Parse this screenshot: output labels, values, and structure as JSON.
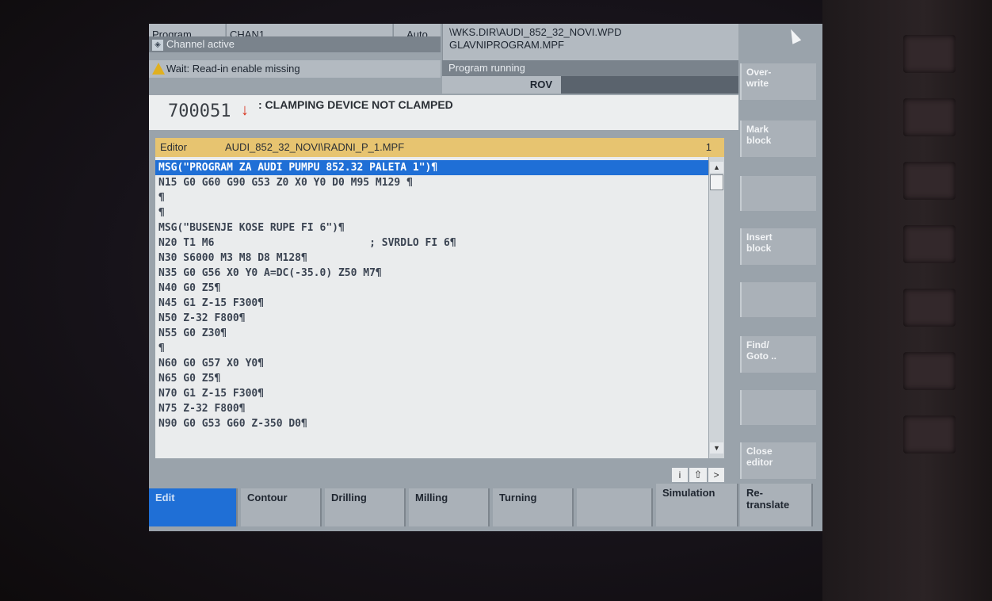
{
  "header": {
    "program_label": "Program",
    "channel": "CHAN1",
    "mode": "Auto",
    "path_line1": "\\WKS.DIR\\AUDI_852_32_NOVI.WPD",
    "path_line2": "GLAVNIPROGRAM.MPF",
    "channel_status": "Channel active",
    "program_status": "Program running",
    "warning": "Wait: Read-in enable missing",
    "rov": "ROV"
  },
  "alarm": {
    "number": "700051",
    "arrow": "↓",
    "text": ": CLAMPING DEVICE NOT CLAMPED"
  },
  "editor": {
    "label": "Editor",
    "file": "AUDI_852_32_NOVI\\RADNI_P_1.MPF",
    "count": "1",
    "lines": [
      "MSG(\"PROGRAM ZA AUDI PUMPU 852.32 PALETA 1\")¶",
      "N15 G0 G60 G90 G53 Z0 X0 Y0 D0 M95 M129 ¶",
      "¶",
      "¶",
      "MSG(\"BUSENJE KOSE RUPE FI 6\")¶",
      "N20 T1 M6                         ; SVRDLO FI 6¶",
      "N30 S6000 M3 M8 D8 M128¶",
      "N35 G0 G56 X0 Y0 A=DC(-35.0) Z50 M7¶",
      "N40 G0 Z5¶",
      "N45 G1 Z-15 F300¶",
      "N50 Z-32 F800¶",
      "N55 G0 Z30¶",
      "¶",
      "N60 G0 G57 X0 Y0¶",
      "N65 G0 Z5¶",
      "N70 G1 Z-15 F300¶",
      "N75 Z-32 F800¶",
      "N90 G0 G53 G60 Z-350 D0¶"
    ]
  },
  "vertical_softkeys": [
    {
      "label": "Over-\nwrite"
    },
    {
      "label": "Mark\nblock"
    },
    {
      "label": ""
    },
    {
      "label": "Insert\nblock"
    },
    {
      "label": ""
    },
    {
      "label": "Find/\nGoto .."
    },
    {
      "label": ""
    },
    {
      "label": "Close\neditor"
    }
  ],
  "horizontal_softkeys": [
    {
      "label": "Edit"
    },
    {
      "label": "Contour"
    },
    {
      "label": "Drilling"
    },
    {
      "label": "Milling"
    },
    {
      "label": "Turning"
    },
    {
      "label": ""
    },
    {
      "label": "Simulation"
    },
    {
      "label": "Re-\ntranslate"
    }
  ],
  "nav_icons": {
    "info": "i",
    "shift": "⇧",
    "next": ">"
  },
  "colors": {
    "accent_blue": "#1f6fd6",
    "editor_title_bar": "#e7c470",
    "selection": "#1f6fd6",
    "warning": "#e0b020",
    "alarm_arrow": "#d8321c"
  }
}
